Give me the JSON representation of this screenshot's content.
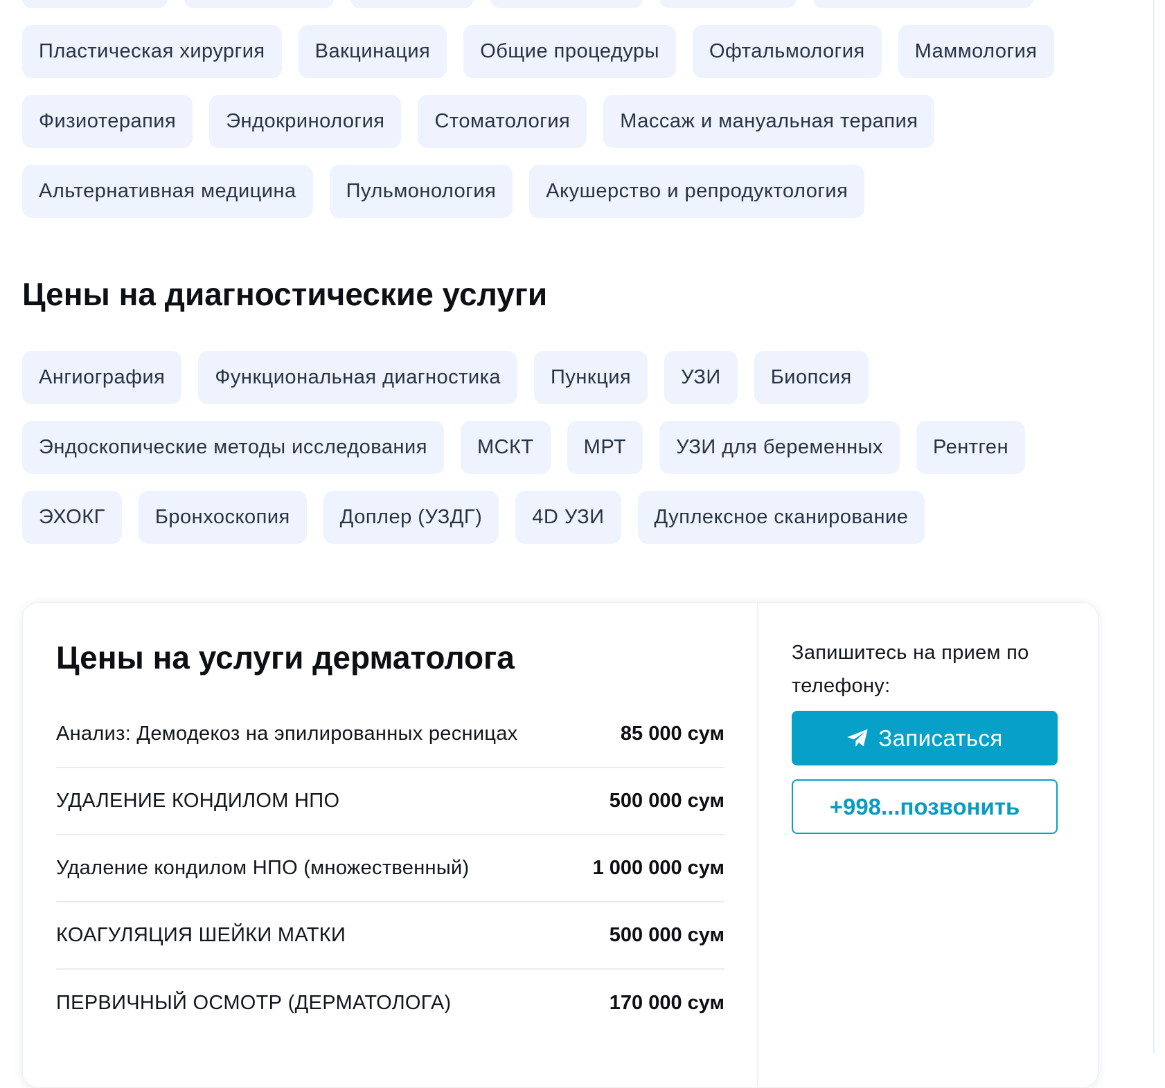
{
  "top_chips": [
    "Пластическая хирургия",
    "Вакцинация",
    "Общие процедуры",
    "Офтальмология",
    "Маммология",
    "Физиотерапия",
    "Эндокринология",
    "Стоматология",
    "Массаж и мануальная терапия",
    "Альтернативная медицина",
    "Пульмонология",
    "Акушерство и репродуктология"
  ],
  "diagnostics": {
    "title": "Цены на диагностические услуги",
    "chips": [
      "Ангиография",
      "Функциональная диагностика",
      "Пункция",
      "УЗИ",
      "Биопсия",
      "Эндоскопические методы исследования",
      "МСКТ",
      "МРТ",
      "УЗИ для беременных",
      "Рентген",
      "ЭХОКГ",
      "Бронхоскопия",
      "Доплер (УЗДГ)",
      "4D УЗИ",
      "Дуплексное сканирование"
    ]
  },
  "prices": {
    "title": "Цены на услуги дерматолога",
    "items": [
      {
        "name": "Анализ: Демодекоз на эпилированных ресницах",
        "price": "85 000 сум"
      },
      {
        "name": "УДАЛЕНИЕ КОНДИЛОМ НПО",
        "price": "500 000 сум"
      },
      {
        "name": "Удаление кондилом НПО (множественный)",
        "price": "1 000 000 сум"
      },
      {
        "name": "КОАГУЛЯЦИЯ ШЕЙКИ МАТКИ",
        "price": "500 000 сум"
      },
      {
        "name": "ПЕРВИЧНЫЙ ОСМОТР (ДЕРМАТОЛОГА)",
        "price": "170 000 сум"
      }
    ]
  },
  "booking": {
    "text": "Запишитесь на прием по телефону:",
    "book_label": "Записаться",
    "book_icon": "telegram-plane-icon",
    "call_label": "+998...позвонить"
  },
  "colors": {
    "chip_bg": "#eef3fe",
    "accent": "#06a0c8",
    "text": "#12161d"
  }
}
